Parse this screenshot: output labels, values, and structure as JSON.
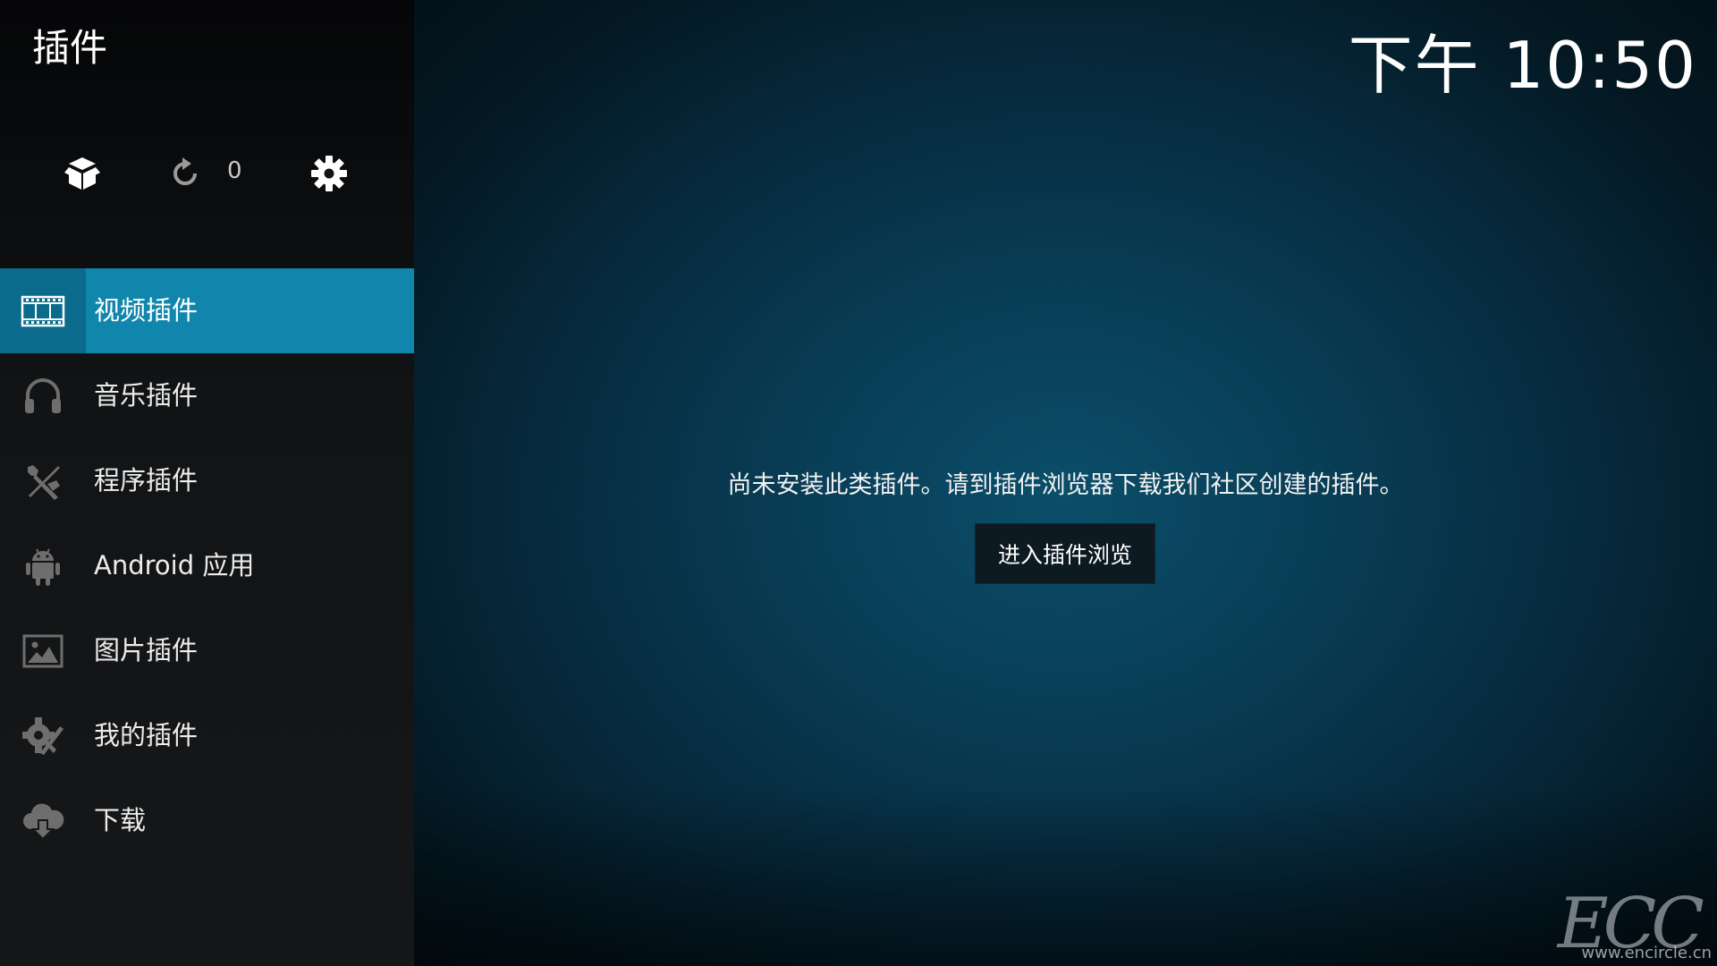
{
  "header": {
    "title": "插件",
    "clock": "下午 10:50"
  },
  "toolbar": {
    "install_icon": "addon-box-icon",
    "update_icon": "refresh-icon",
    "update_count": "0",
    "settings_icon": "gear-icon"
  },
  "sidebar": {
    "items": [
      {
        "label": "视频插件",
        "icon": "film-strip-icon",
        "active": true
      },
      {
        "label": "音乐插件",
        "icon": "headphones-icon",
        "active": false
      },
      {
        "label": "程序插件",
        "icon": "tools-icon",
        "active": false
      },
      {
        "label": "Android 应用",
        "icon": "android-icon",
        "active": false
      },
      {
        "label": "图片插件",
        "icon": "picture-icon",
        "active": false
      },
      {
        "label": "我的插件",
        "icon": "my-addons-icon",
        "active": false
      },
      {
        "label": "下载",
        "icon": "cloud-download-icon",
        "active": false
      }
    ]
  },
  "main": {
    "empty_message": "尚未安装此类插件。请到插件浏览器下载我们社区创建的插件。",
    "browse_button": "进入插件浏览"
  },
  "watermark": {
    "logo": "ECC",
    "url": "www.encircle.cn"
  },
  "colors": {
    "active_item": "#1186ad",
    "active_icon_cell": "#0b6b8c",
    "background": "#083a52"
  }
}
